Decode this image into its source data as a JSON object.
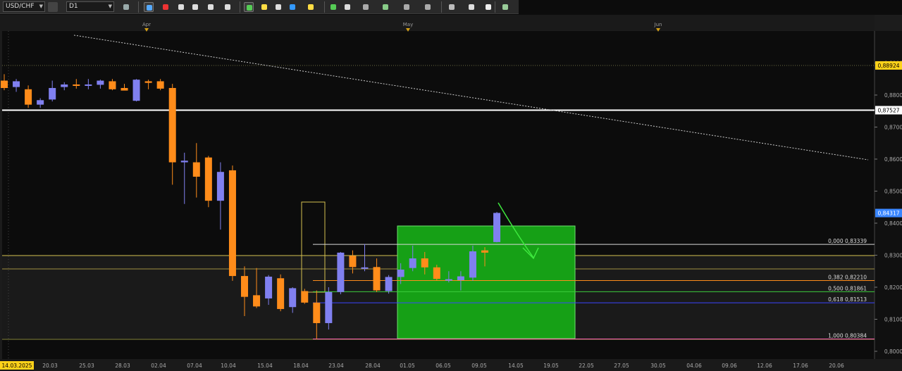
{
  "toolbar": {
    "symbol": "USD/CHF",
    "timeframe": "D1",
    "icons": [
      "chart-type-icon",
      "crosshair-icon",
      "line-icon",
      "zoom-in-icon",
      "zoom-out-icon",
      "cursor-icon",
      "indicator-icon",
      "template-icon",
      "color-icon",
      "globe-icon",
      "pencil-icon",
      "draw-icon",
      "buy-icon",
      "sell-icon",
      "order-icon",
      "period-icon",
      "fib-icon",
      "more-icon",
      "circle-icon",
      "screen-icon",
      "eraser-icon",
      "settings-icon"
    ]
  },
  "months": [
    {
      "label": "Apr",
      "x": 208
    },
    {
      "label": "May",
      "x": 579
    },
    {
      "label": "Jun",
      "x": 934
    }
  ],
  "price_labels": {
    "high_mark": "0,88924",
    "white_line": "0,87527",
    "current": "0,84317"
  },
  "fib_labels": [
    {
      "label": "0,000 0,83339"
    },
    {
      "label": "0,382 0,82210"
    },
    {
      "label": "0,500 0,81861"
    },
    {
      "label": "0,618 0,81513"
    },
    {
      "label": "1,000 0,80384"
    }
  ],
  "y_ticks": [
    "0,8900",
    "0,8800",
    "0,8700",
    "0,8600",
    "0,8500",
    "0,8400",
    "0,8300",
    "0,8200",
    "0,8100",
    "0,8000"
  ],
  "x_ticks": [
    "14.03.2025",
    "20.03",
    "25.03",
    "28.03",
    "02.04",
    "07.04",
    "10.04",
    "15.04",
    "18.04",
    "23.04",
    "28.04",
    "01.05",
    "06.05",
    "09.05",
    "14.05",
    "19.05",
    "22.05",
    "27.05",
    "30.05",
    "04.06",
    "09.06",
    "12.06",
    "17.06",
    "20.06"
  ],
  "chart_data": {
    "type": "candlestick",
    "symbol": "USD/CHF",
    "timeframe": "D1",
    "ylim": [
      0.8,
      0.893
    ],
    "candles": [
      {
        "o": 0.8845,
        "h": 0.8865,
        "l": 0.8815,
        "c": 0.8822
      },
      {
        "o": 0.8825,
        "h": 0.885,
        "l": 0.881,
        "c": 0.8843
      },
      {
        "o": 0.8818,
        "h": 0.883,
        "l": 0.876,
        "c": 0.877
      },
      {
        "o": 0.877,
        "h": 0.879,
        "l": 0.876,
        "c": 0.8784
      },
      {
        "o": 0.8786,
        "h": 0.8845,
        "l": 0.878,
        "c": 0.8822
      },
      {
        "o": 0.8825,
        "h": 0.884,
        "l": 0.8815,
        "c": 0.8833
      },
      {
        "o": 0.8833,
        "h": 0.885,
        "l": 0.882,
        "c": 0.8832
      },
      {
        "o": 0.8832,
        "h": 0.885,
        "l": 0.8818,
        "c": 0.8833
      },
      {
        "o": 0.8832,
        "h": 0.8848,
        "l": 0.882,
        "c": 0.8845
      },
      {
        "o": 0.8843,
        "h": 0.885,
        "l": 0.8815,
        "c": 0.8818
      },
      {
        "o": 0.8822,
        "h": 0.8835,
        "l": 0.8815,
        "c": 0.8814
      },
      {
        "o": 0.8782,
        "h": 0.885,
        "l": 0.878,
        "c": 0.8848
      },
      {
        "o": 0.8843,
        "h": 0.8848,
        "l": 0.8818,
        "c": 0.8838
      },
      {
        "o": 0.8843,
        "h": 0.885,
        "l": 0.8815,
        "c": 0.882
      },
      {
        "o": 0.8822,
        "h": 0.8835,
        "l": 0.852,
        "c": 0.859
      },
      {
        "o": 0.859,
        "h": 0.862,
        "l": 0.846,
        "c": 0.8595
      },
      {
        "o": 0.859,
        "h": 0.865,
        "l": 0.848,
        "c": 0.8545
      },
      {
        "o": 0.8605,
        "h": 0.861,
        "l": 0.845,
        "c": 0.847
      },
      {
        "o": 0.847,
        "h": 0.859,
        "l": 0.838,
        "c": 0.856
      },
      {
        "o": 0.8565,
        "h": 0.858,
        "l": 0.822,
        "c": 0.8235
      },
      {
        "o": 0.8235,
        "h": 0.8265,
        "l": 0.811,
        "c": 0.817
      },
      {
        "o": 0.8175,
        "h": 0.826,
        "l": 0.8135,
        "c": 0.814
      },
      {
        "o": 0.8165,
        "h": 0.8238,
        "l": 0.8145,
        "c": 0.8233
      },
      {
        "o": 0.8228,
        "h": 0.824,
        "l": 0.8125,
        "c": 0.8132
      },
      {
        "o": 0.8138,
        "h": 0.82,
        "l": 0.812,
        "c": 0.8197
      },
      {
        "o": 0.8188,
        "h": 0.8195,
        "l": 0.8148,
        "c": 0.8152
      },
      {
        "o": 0.8152,
        "h": 0.819,
        "l": 0.8038,
        "c": 0.8088
      },
      {
        "o": 0.8088,
        "h": 0.82,
        "l": 0.8068,
        "c": 0.8185
      },
      {
        "o": 0.8185,
        "h": 0.831,
        "l": 0.8178,
        "c": 0.8308
      },
      {
        "o": 0.8298,
        "h": 0.8315,
        "l": 0.8243,
        "c": 0.8263
      },
      {
        "o": 0.8258,
        "h": 0.8335,
        "l": 0.825,
        "c": 0.8262
      },
      {
        "o": 0.8263,
        "h": 0.829,
        "l": 0.8185,
        "c": 0.819
      },
      {
        "o": 0.8188,
        "h": 0.8238,
        "l": 0.818,
        "c": 0.8232
      },
      {
        "o": 0.8232,
        "h": 0.8275,
        "l": 0.821,
        "c": 0.8255
      },
      {
        "o": 0.826,
        "h": 0.833,
        "l": 0.825,
        "c": 0.829
      },
      {
        "o": 0.829,
        "h": 0.831,
        "l": 0.824,
        "c": 0.8262
      },
      {
        "o": 0.8262,
        "h": 0.827,
        "l": 0.822,
        "c": 0.8226
      },
      {
        "o": 0.8223,
        "h": 0.825,
        "l": 0.8215,
        "c": 0.8225
      },
      {
        "o": 0.8222,
        "h": 0.825,
        "l": 0.819,
        "c": 0.8234
      },
      {
        "o": 0.823,
        "h": 0.833,
        "l": 0.822,
        "c": 0.8312
      },
      {
        "o": 0.8315,
        "h": 0.8325,
        "l": 0.8265,
        "c": 0.8308
      },
      {
        "o": 0.8341,
        "h": 0.8435,
        "l": 0.834,
        "c": 0.8432
      }
    ],
    "fibonacci": [
      {
        "level": "0,000",
        "price": 0.83339
      },
      {
        "level": "0,382",
        "price": 0.8221
      },
      {
        "level": "0,500",
        "price": 0.81861
      },
      {
        "level": "0,618",
        "price": 0.81513
      },
      {
        "level": "1,000",
        "price": 0.80384
      }
    ],
    "horizontal_lines": [
      {
        "price": 0.87527,
        "color": "#ffffff"
      },
      {
        "price": 0.88924,
        "color": "#c8c850"
      }
    ],
    "current_price": 0.84317,
    "colors": {
      "bull": "#8080f0",
      "bear": "#ff8c1a",
      "green_box": "#16a016",
      "fib_line": "#e0e0e0",
      "background": "#0c0c0c"
    }
  }
}
